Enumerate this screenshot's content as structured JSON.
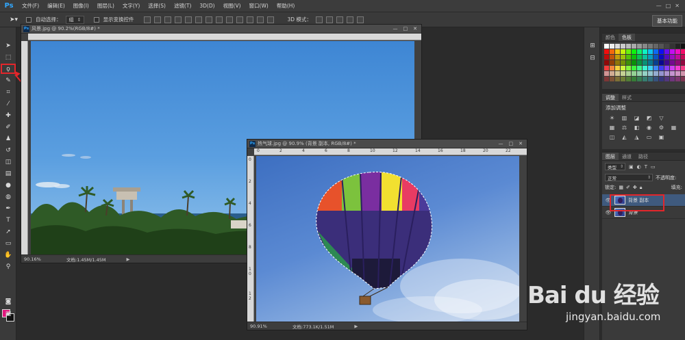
{
  "app": {
    "logo": "Ps"
  },
  "menu": [
    "文件(F)",
    "编辑(E)",
    "图像(I)",
    "图层(L)",
    "文字(Y)",
    "选择(S)",
    "滤镜(T)",
    "3D(D)",
    "视图(V)",
    "窗口(W)",
    "帮助(H)"
  ],
  "options": {
    "auto_select_label": "自动选择：",
    "auto_select_value": "组",
    "show_transform_label": "显示变换控件",
    "mode_3d_label": "3D 模式：",
    "workspace_button": "基本功能"
  },
  "doc1": {
    "title": "风景.jpg @ 90.2%(RGB/8#) *",
    "zoom": "90.16%",
    "info": "文档:1.45M/1.45M"
  },
  "doc2": {
    "title": "热气球.jpg @ 90.9% (背景 副本, RGB/8#) *",
    "zoom": "90.91%",
    "info": "文档:773.1K/1.51M",
    "ruler_h": [
      "0",
      "2",
      "4",
      "6",
      "8",
      "10",
      "12",
      "14",
      "16",
      "18",
      "20",
      "22"
    ],
    "ruler_v": [
      "0",
      "2",
      "4",
      "6",
      "8",
      "1 0",
      "1 2"
    ]
  },
  "color_panel": {
    "tabs": [
      "颜色",
      "色板"
    ]
  },
  "adjust_panel": {
    "tabs": [
      "调整",
      "样式"
    ],
    "title": "添加调整"
  },
  "layers_panel": {
    "tabs": [
      "图层",
      "通道",
      "路径"
    ],
    "filter_label": "类型",
    "blend_mode": "正常",
    "opacity_label": "不透明度:",
    "lock_label": "锁定:",
    "fill_label": "填充:",
    "layers": [
      {
        "name": "背景 副本",
        "selected": true
      },
      {
        "name": "背景",
        "selected": false
      }
    ]
  },
  "watermark": {
    "brand": "Bai du 经验",
    "url": "jingyan.baidu.com"
  },
  "colors": {
    "accent": "#31a8ff",
    "annotation": "#e3262b",
    "foreground": "#e0147c",
    "background": "#111111"
  }
}
